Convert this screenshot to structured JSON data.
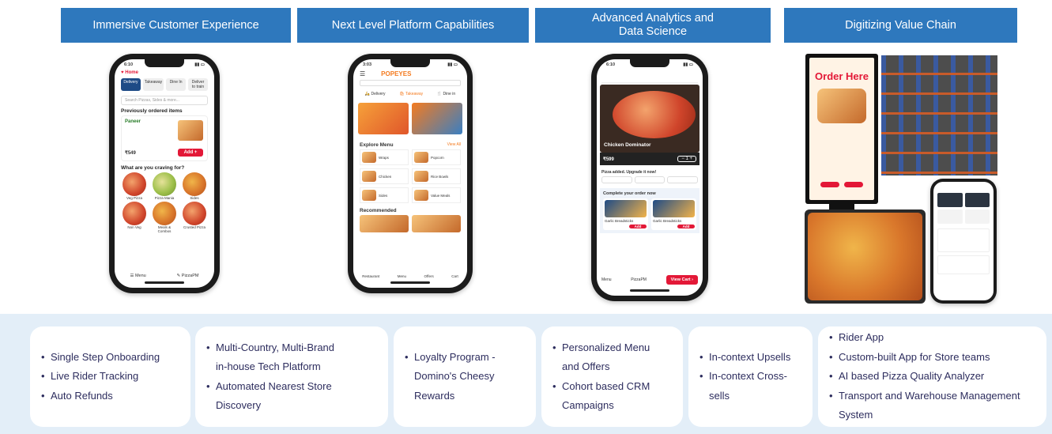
{
  "headers": [
    {
      "lines": [
        "Immersive Customer Experience"
      ]
    },
    {
      "lines": [
        "Next Level Platform Capabilities"
      ]
    },
    {
      "lines": [
        "Advanced Analytics and",
        "Data Science"
      ]
    },
    {
      "lines": [
        "Digitizing Value Chain"
      ]
    }
  ],
  "cards": [
    {
      "items": [
        "Single Step Onboarding",
        "Live Rider Tracking",
        "Auto Refunds"
      ]
    },
    {
      "items": [
        "Multi-Country, Multi-Brand",
        "in-house Tech Platform",
        "Automated Nearest Store",
        "Discovery"
      ],
      "bullets": [
        true,
        false,
        true,
        false
      ]
    },
    {
      "items": [
        "Loyalty Program -",
        "Domino's Cheesy",
        "Rewards"
      ],
      "bullets": [
        true,
        false,
        false
      ]
    },
    {
      "items": [
        "Personalized Menu",
        "and Offers",
        "Cohort based CRM",
        "Campaigns"
      ],
      "bullets": [
        true,
        false,
        true,
        false
      ]
    },
    {
      "items": [
        "In-context Upsells",
        "In-context Cross-",
        "sells"
      ],
      "bullets": [
        true,
        true,
        false
      ]
    },
    {
      "items": [
        "Rider App",
        "Custom-built App for Store teams",
        "AI based Pizza Quality Analyzer",
        "Transport and Warehouse Management",
        "System"
      ],
      "bullets": [
        true,
        true,
        true,
        true,
        false
      ]
    }
  ],
  "phone1": {
    "time": "6:10",
    "deliver_to": "Home",
    "tabs": [
      "Delivery",
      "Takeaway",
      "Dine In",
      "Deliver to train"
    ],
    "search_placeholder": "Search Pizzas, Sides & more...",
    "section_prev": "Previously ordered items",
    "item_name": "Paneer",
    "price": "₹549",
    "add_label": "Add",
    "section_crave": "What are you craving for?",
    "categories": [
      "Veg Pizza",
      "Pizza Mania",
      "Sides",
      "Non Veg",
      "Meals & Combos",
      "Crusted Pizza"
    ],
    "nav": [
      "Menu",
      "PizzaPM"
    ]
  },
  "phone2": {
    "time": "3:03",
    "brand": "POPEYES",
    "modes": [
      "Delivery",
      "Takeaway",
      "Dine in"
    ],
    "section_explore": "Explore Menu",
    "view_all": "View All",
    "menu": [
      "Wraps",
      "Popcorn",
      "Chicken",
      "Rice Bowls",
      "Sides",
      "Value Meals"
    ],
    "section_rec": "Recommended",
    "nav": [
      "Restaurant",
      "Menu",
      "Offers",
      "Cart"
    ]
  },
  "phone3": {
    "time": "6:10",
    "product": "Chicken Dominator",
    "price": "₹599",
    "upgrade": "Pizza added. Upgrade it now!",
    "complete": "Complete your order now",
    "item1": "Garlic Breadsticks",
    "item2": "Garlic Breadsticks",
    "add_label": "Add",
    "view_cart": "View Cart",
    "nav": [
      "Menu",
      "PizzaPM"
    ]
  },
  "kiosk": {
    "title": "Order Here"
  },
  "colors": {
    "header_bg": "#2e78bd",
    "panel_bg": "#e3eef8",
    "card_text": "#2d2d5e",
    "dominos_red": "#e31837",
    "popeyes_orange": "#f47b20"
  }
}
